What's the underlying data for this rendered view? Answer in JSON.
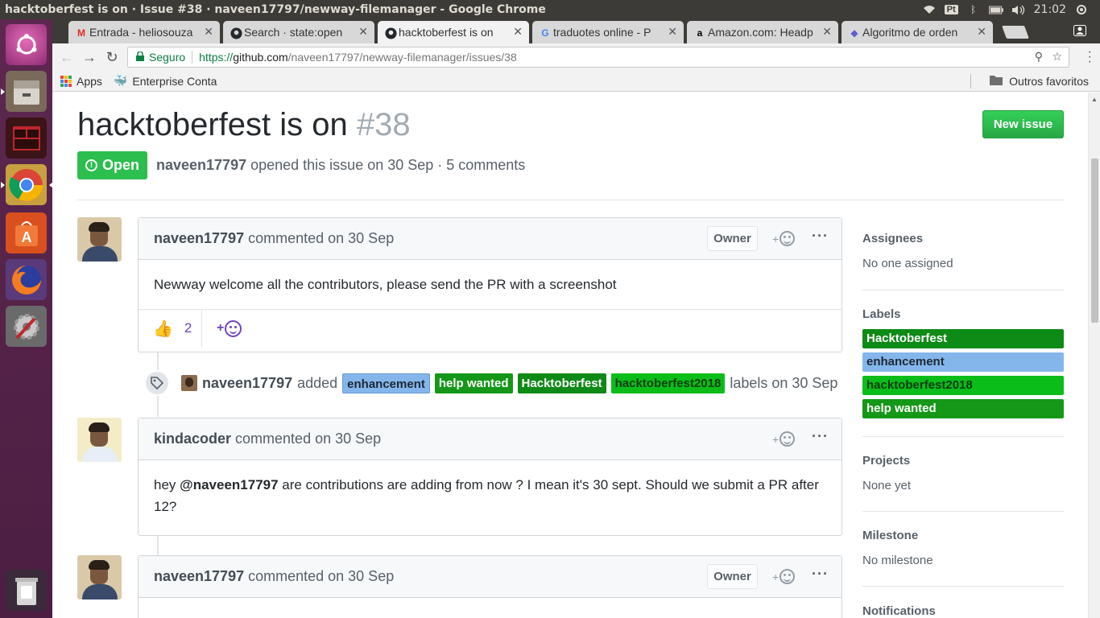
{
  "window": {
    "title": "hacktoberfest is on · Issue #38 · naveen17797/newway-filemanager - Google Chrome"
  },
  "system_tray": {
    "input_method": "Pt",
    "time": "21:02"
  },
  "launcher": {
    "items": [
      {
        "name": "ubuntu-dash-icon"
      },
      {
        "name": "files-icon"
      },
      {
        "name": "terminal-icon"
      },
      {
        "name": "chrome-icon"
      },
      {
        "name": "software-center-icon"
      },
      {
        "name": "firefox-icon"
      },
      {
        "name": "system-settings-icon"
      },
      {
        "name": "trash-icon"
      }
    ]
  },
  "tabs": [
    {
      "title": "Entrada - heliosouza",
      "favicon": "M",
      "color": "#d93025"
    },
    {
      "title": "Search · state:open",
      "favicon": "⬤",
      "color": "#24292e"
    },
    {
      "title": "hacktoberfest is on",
      "favicon": "⬤",
      "color": "#24292e",
      "active": true
    },
    {
      "title": "traduotes online - P",
      "favicon": "G",
      "color": "#4285f4"
    },
    {
      "title": "Amazon.com: Headp",
      "favicon": "a",
      "color": "#000000"
    },
    {
      "title": "Algoritmo de orden",
      "favicon": "◆",
      "color": "#5c5ccc"
    }
  ],
  "omnibox": {
    "secure_label": "Seguro",
    "scheme": "https://",
    "host": "github.com",
    "path": "/naveen17797/newway-filemanager/issues/38"
  },
  "bookmarks": {
    "apps_label": "Apps",
    "enterprise_label": "Enterprise Conta",
    "other_label": "Outros favoritos"
  },
  "issue": {
    "title": "hacktoberfest is on",
    "number": "#38",
    "new_issue_label": "New issue",
    "state_label": "Open",
    "author": "naveen17797",
    "meta_text": "opened this issue on 30 Sep · 5 comments"
  },
  "comments": [
    {
      "author": "naveen17797",
      "action": "commented on 30 Sep",
      "badge": "Owner",
      "body": "Newway welcome all the contributors, please send the PR with a screenshot",
      "reaction_count": "2"
    },
    {
      "author": "kindacoder",
      "action": "commented on 30 Sep",
      "body_mention": "@naveen17797",
      "body_pre": "hey ",
      "body_post": " are contributions are adding from now ? I mean it's 30 sept. Should we submit a PR after 12?"
    },
    {
      "author": "naveen17797",
      "action": "commented on 30 Sep",
      "badge": "Owner"
    }
  ],
  "label_event": {
    "actor": "naveen17797",
    "verb": "added",
    "suffix": "labels on 30 Sep",
    "labels": [
      {
        "name": "enhancement",
        "bg": "#84b6eb",
        "fg": "#1c2733"
      },
      {
        "name": "help wanted",
        "bg": "#159818",
        "fg": "#ffffff"
      },
      {
        "name": "Hacktoberfest",
        "bg": "#0e8a16",
        "fg": "#ffffff"
      },
      {
        "name": "hacktoberfest2018",
        "bg": "#0bbd19",
        "fg": "#0a3d0f"
      }
    ]
  },
  "sidebar": {
    "assignees": {
      "heading": "Assignees",
      "value": "No one assigned"
    },
    "labels": {
      "heading": "Labels",
      "items": [
        {
          "name": "Hacktoberfest",
          "bg": "#0e8a16",
          "fg": "#ffffff"
        },
        {
          "name": "enhancement",
          "bg": "#84b6eb",
          "fg": "#1c2733"
        },
        {
          "name": "hacktoberfest2018",
          "bg": "#0bbd19",
          "fg": "#0a3d0f"
        },
        {
          "name": "help wanted",
          "bg": "#159818",
          "fg": "#ffffff"
        }
      ]
    },
    "projects": {
      "heading": "Projects",
      "value": "None yet"
    },
    "milestone": {
      "heading": "Milestone",
      "value": "No milestone"
    },
    "notifications": {
      "heading": "Notifications"
    }
  }
}
